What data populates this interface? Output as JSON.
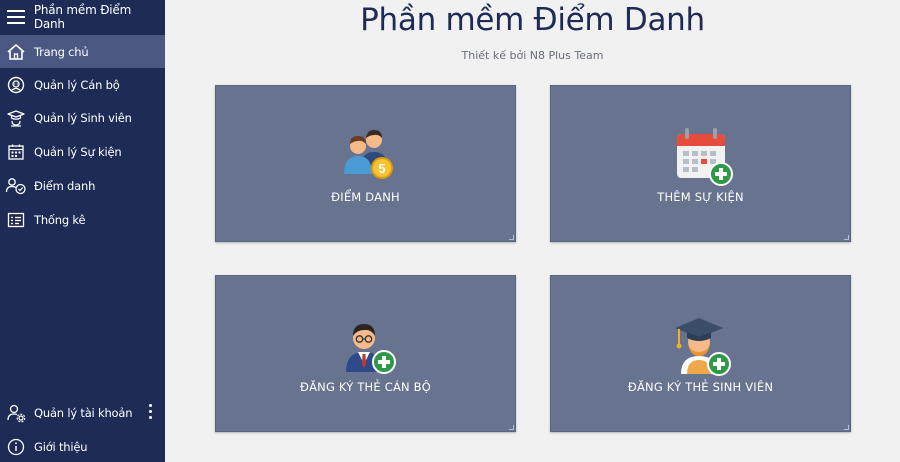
{
  "sidebar": {
    "title": "Phần mềm Điểm Danh",
    "items": [
      {
        "label": "Trang chủ",
        "icon": "home-icon"
      },
      {
        "label": "Quản lý Cán bộ",
        "icon": "staff-icon"
      },
      {
        "label": "Quản lý Sinh viên",
        "icon": "student-icon"
      },
      {
        "label": "Quản lý Sự kiện",
        "icon": "calendar-icon"
      },
      {
        "label": "Điểm danh",
        "icon": "attendance-icon"
      },
      {
        "label": "Thống kê",
        "icon": "statistics-icon"
      }
    ],
    "account_label": "Quản lý tài khoản",
    "about_label": "Giới thiệu"
  },
  "main": {
    "title": "Phần mềm Điểm Danh",
    "subtitle": "Thiết kế bởi N8 Plus Team",
    "tiles": [
      {
        "label": "ĐIỂM DANH",
        "icon": "users-coin-icon"
      },
      {
        "label": "THÊM SỰ KIỆN",
        "icon": "calendar-add-icon"
      },
      {
        "label": "ĐĂNG KÝ THẺ CÁN BỘ",
        "icon": "teacher-add-icon"
      },
      {
        "label": "ĐĂNG KÝ THẺ SINH VIÊN",
        "icon": "graduate-add-icon"
      }
    ]
  },
  "colors": {
    "sidebar_bg": "#1e2b57",
    "sidebar_active": "#4a5883",
    "tile_bg": "#68738f",
    "title_color": "#1e2b57",
    "page_bg": "#f1f1f1"
  }
}
